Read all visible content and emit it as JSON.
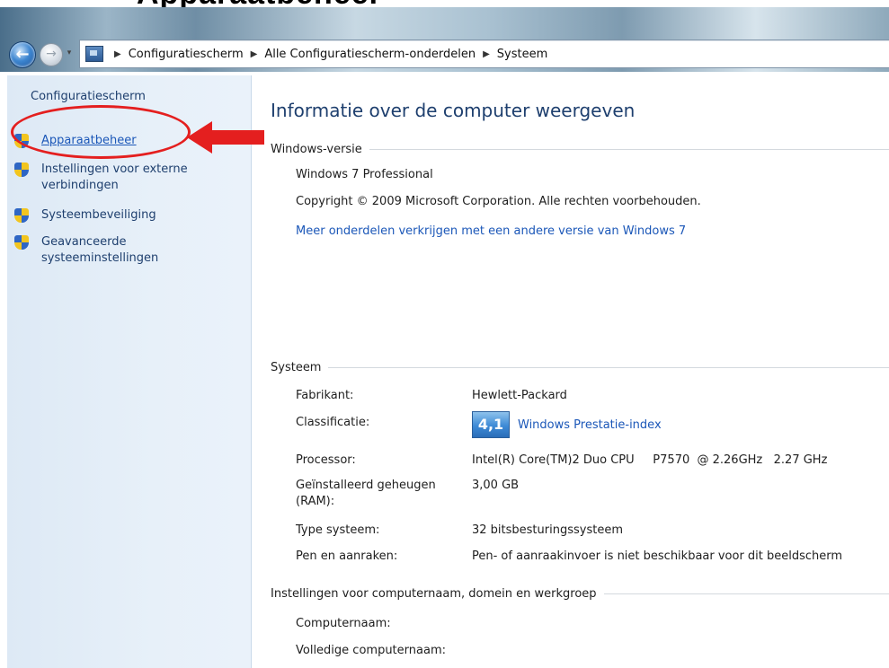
{
  "header_text": "Apparaatbeheer",
  "address_bar": {
    "breadcrumbs": [
      "Configuratiescherm",
      "Alle Configuratiescherm-onderdelen",
      "Systeem"
    ]
  },
  "left_pane": {
    "home_link": "Configuratiescherm",
    "tasks": [
      {
        "label": "Apparaatbeheer",
        "icon": "uac-shield-icon"
      },
      {
        "label": "Instellingen voor externe verbindingen",
        "icon": "uac-shield-icon"
      },
      {
        "label": "Systeembeveiliging",
        "icon": "uac-shield-icon"
      },
      {
        "label": "Geavanceerde systeeminstellingen",
        "icon": "uac-shield-icon"
      }
    ]
  },
  "main": {
    "title": "Informatie over de computer weergeven",
    "windows_edition": {
      "group_label": "Windows-versie",
      "edition": "Windows 7 Professional",
      "copyright": "Copyright © 2009 Microsoft Corporation. Alle rechten voorbehouden.",
      "upgrade_link": "Meer onderdelen verkrijgen met een andere versie van Windows 7"
    },
    "system": {
      "group_label": "Systeem",
      "rows": [
        {
          "label": "Fabrikant:",
          "value": "Hewlett-Packard"
        },
        {
          "label": "Classificatie:",
          "value": ""
        },
        {
          "label": "Processor:",
          "value": "Intel(R) Core(TM)2 Duo CPU     P7570  @ 2.26GHz   2.27 GHz"
        },
        {
          "label": "Geïnstalleerd geheugen (RAM):",
          "value": "3,00 GB"
        },
        {
          "label": "Type systeem:",
          "value": "32 bitsbesturingssysteem"
        },
        {
          "label": "Pen en aanraken:",
          "value": "Pen- of aanraakinvoer is niet beschikbaar voor dit beeldscherm"
        }
      ],
      "rating_score": "4,1",
      "rating_link": "Windows Prestatie-index"
    },
    "computer_name": {
      "group_label": "Instellingen voor computernaam, domein en werkgroep",
      "rows": [
        {
          "label": "Computernaam:"
        },
        {
          "label": "Volledige computernaam:"
        }
      ]
    }
  },
  "colors": {
    "link": "#1b57b8",
    "nav_text": "#1e3f6e",
    "annotation": "#e41f1f",
    "left_pane_bg": "#e4eef8"
  }
}
